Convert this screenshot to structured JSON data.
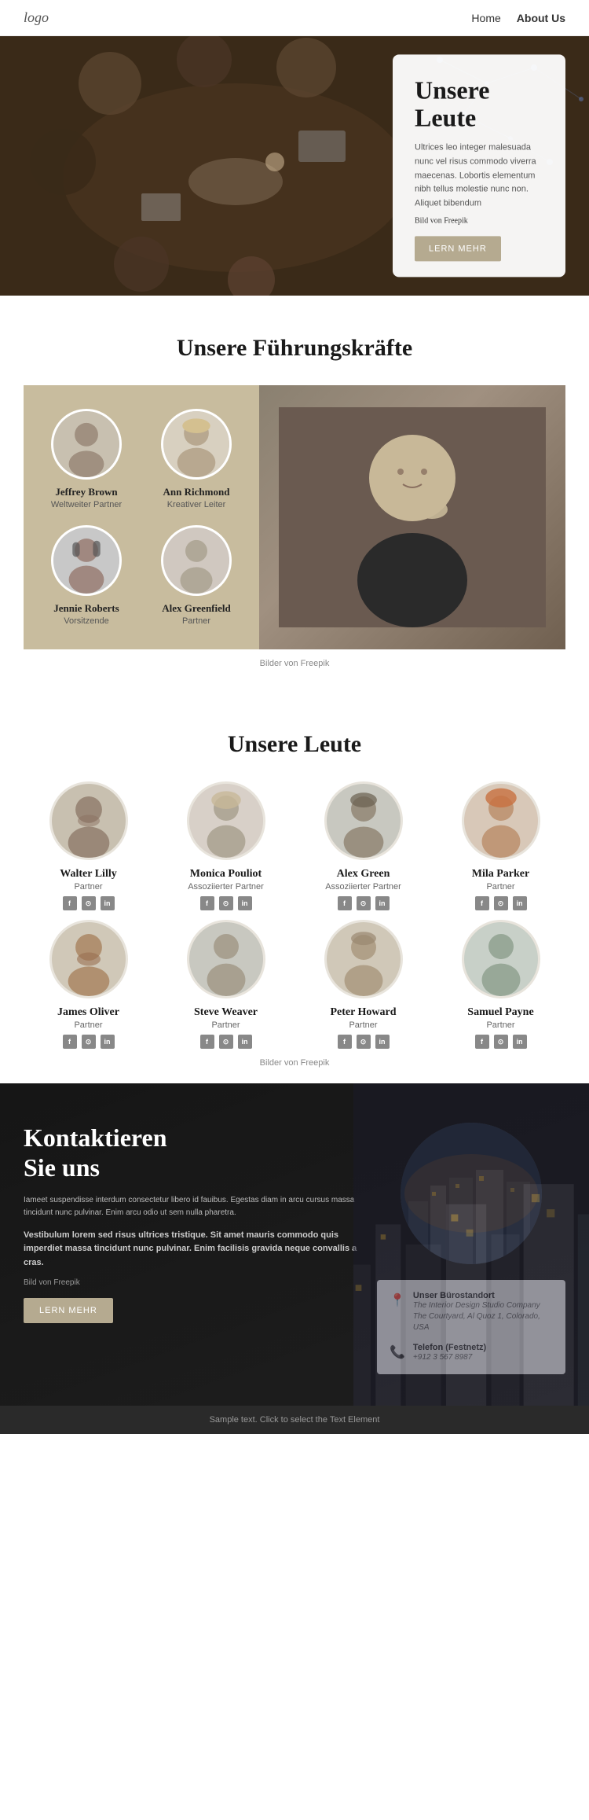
{
  "nav": {
    "logo": "logo",
    "links": [
      {
        "label": "Home",
        "active": false
      },
      {
        "label": "About Us",
        "active": true
      }
    ]
  },
  "hero": {
    "title_line1": "Unsere",
    "title_line2": "Leute",
    "description": "Ultrices leo integer malesuada nunc vel risus commodo viverra maecenas. Lobortis elementum nibh tellus molestie nunc non. Aliquet bibendum",
    "image_credit": "Bild von Freepik",
    "button": "LERN MEHR"
  },
  "fuhrung": {
    "section_title": "Unsere Führungskräfte",
    "people": [
      {
        "name": "Jeffrey Brown",
        "title": "Weltweiter Partner",
        "gender": "m"
      },
      {
        "name": "Ann Richmond",
        "title": "Kreativer Leiter",
        "gender": "f"
      },
      {
        "name": "Jennie Roberts",
        "title": "Vorsitzende",
        "gender": "f"
      },
      {
        "name": "Alex Greenfield",
        "title": "Partner",
        "gender": "m"
      }
    ],
    "image_credit": "Bilder von Freepik"
  },
  "leute": {
    "section_title": "Unsere Leute",
    "row1": [
      {
        "name": "Walter Lilly",
        "role": "Partner",
        "gender": "m"
      },
      {
        "name": "Monica Pouliot",
        "role": "Assoziierter Partner",
        "gender": "f"
      },
      {
        "name": "Alex Green",
        "role": "Assoziierter Partner",
        "gender": "m"
      },
      {
        "name": "Mila Parker",
        "role": "Partner",
        "gender": "f"
      }
    ],
    "row2": [
      {
        "name": "James Oliver",
        "role": "Partner",
        "gender": "m"
      },
      {
        "name": "Steve Weaver",
        "role": "Partner",
        "gender": "m"
      },
      {
        "name": "Peter Howard",
        "role": "Partner",
        "gender": "m"
      },
      {
        "name": "Samuel Payne",
        "role": "Partner",
        "gender": "m"
      }
    ],
    "image_credit": "Bilder von Freepik",
    "social": [
      "f",
      "⊙",
      "in"
    ]
  },
  "kontakt": {
    "title_line1": "Kontaktieren",
    "title_line2": "Sie uns",
    "para1": "Iameet suspendisse interdum consectetur libero id fauibus. Egestas diam in arcu cursus massa tincidunt nunc pulvinar. Enim arcu odio ut sem nulla pharetra.",
    "para2": "Vestibulum lorem sed risus ultrices tristique. Sit amet mauris commodo quis imperdiet massa tincidunt nunc pulvinar. Enim facilisis gravida neque convallis a cras.",
    "image_credit": "Bild von Freepik",
    "button": "LERN MEHR",
    "office_label": "Unser Bürostandort",
    "office_line1": "The Interior Design Studio Company",
    "office_line2": "The Courtyard, Al Quoz 1, Colorado, USA",
    "phone_label": "Telefon (Festnetz)",
    "phone_number": "+912 3 567 8987"
  },
  "footer": {
    "text": "Sample text. Click to select the Text Element"
  }
}
